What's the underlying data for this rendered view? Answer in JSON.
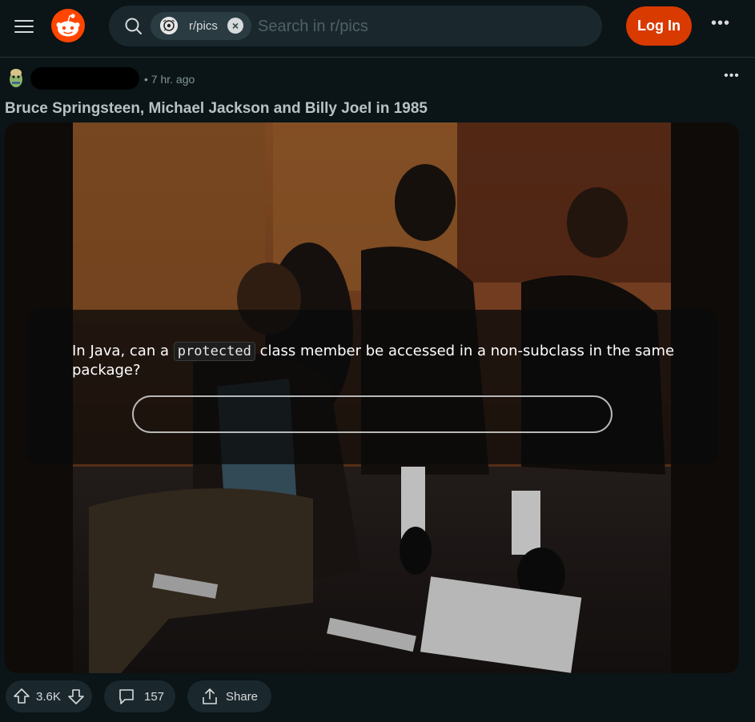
{
  "header": {
    "subreddit_chip": "r/pics",
    "search_placeholder": "Search in r/pics",
    "login_label": "Log In",
    "more_label": "•••"
  },
  "post": {
    "time": "• 7 hr. ago",
    "more_label": "•••",
    "title": "Bruce Springsteen, Michael Jackson and Billy Joel in 1985",
    "upvotes": "3.6K",
    "comments": "157",
    "share_label": "Share"
  },
  "quiz": {
    "prefix": "In Java, can a ",
    "code": "protected",
    "suffix": " class member be accessed in a non-subclass in the same package?",
    "answer_value": ""
  },
  "colors": {
    "background": "#0b1416",
    "brand": "#ff4500",
    "login_button": "#d93a00",
    "pill": "#1a282d"
  },
  "icons": {
    "menu": "hamburger-icon",
    "logo": "reddit-logo",
    "search": "search-icon",
    "chip_close": "close-icon",
    "upvote": "upvote-arrow-icon",
    "downvote": "downvote-arrow-icon",
    "comment": "comment-bubble-icon",
    "share": "share-icon"
  }
}
